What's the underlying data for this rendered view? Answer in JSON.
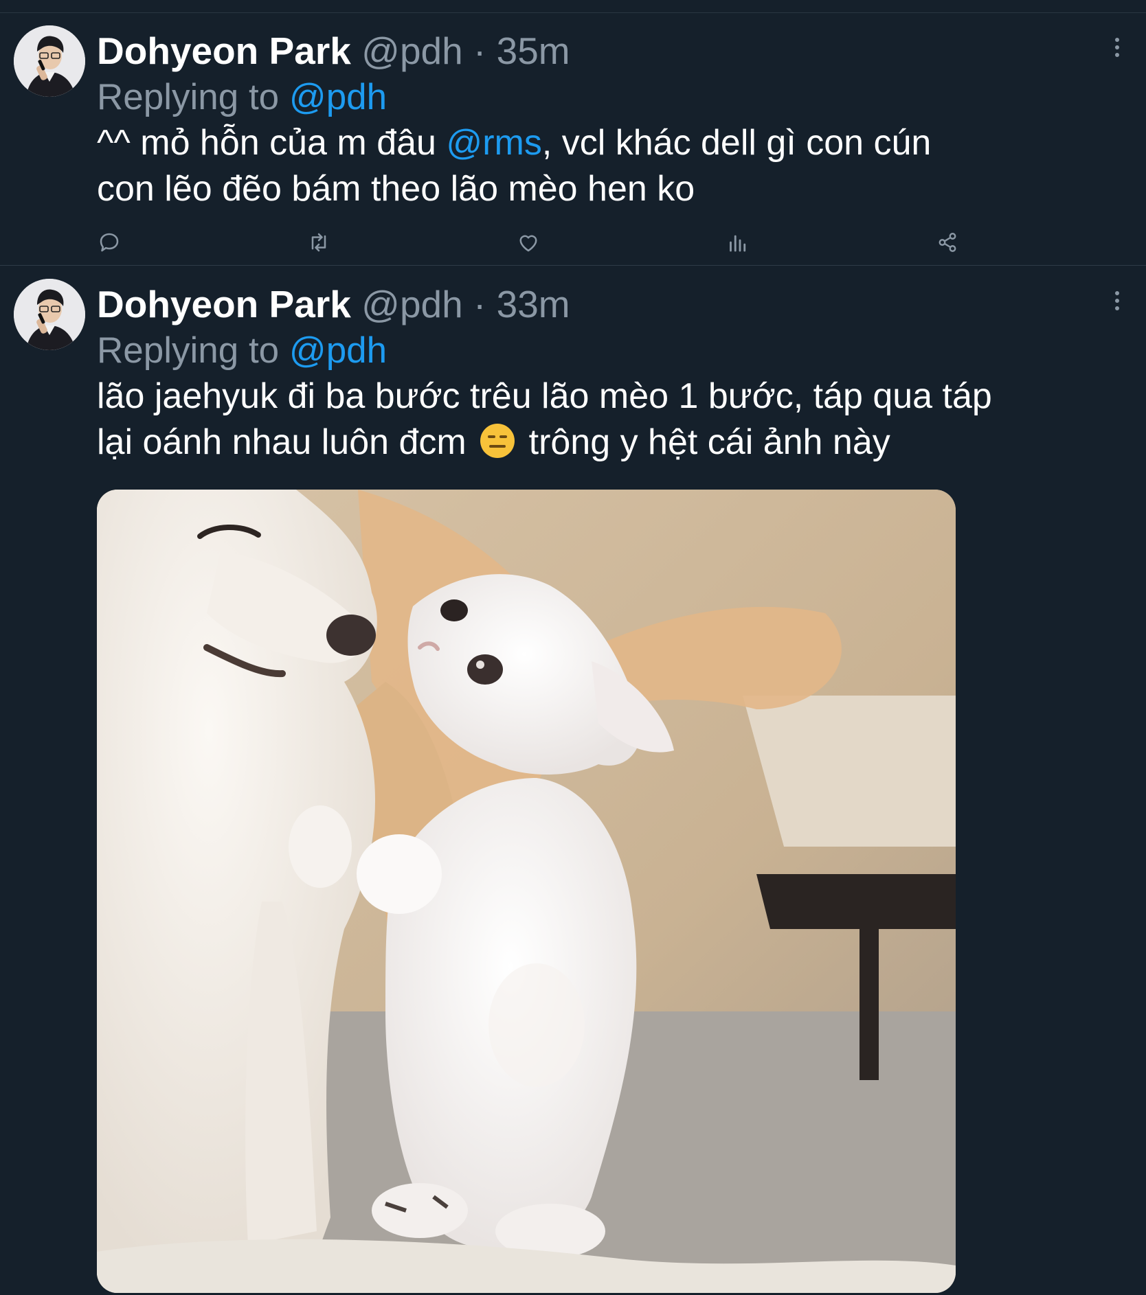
{
  "tweets": [
    {
      "author_name": "Dohyeon Park",
      "author_handle": "@pdh",
      "separator": "·",
      "time": "35m",
      "replying_prefix": "Replying to ",
      "replying_handle": "@pdh",
      "text_line1_a": "^^ mỏ hỗn của m đâu ",
      "text_line1_mention": "@rms",
      "text_line1_b": ", vcl khác dell gì con cún",
      "text_line2": "con lẽo đẽo bám theo lão mèo hen ko",
      "actions": [
        "reply-icon",
        "retweet-icon",
        "like-icon",
        "analytics-icon",
        "share-icon"
      ]
    },
    {
      "author_name": "Dohyeon Park",
      "author_handle": "@pdh",
      "separator": "·",
      "time": "33m",
      "replying_prefix": "Replying to ",
      "replying_handle": "@pdh",
      "text_line1": "lão jaehyuk đi ba bước trêu lão mèo 1 bước, táp qua táp",
      "text_line2_a": "lại oánh nhau luôn đcm ",
      "text_line2_emoji": "expressionless-face-emoji",
      "text_line2_b": " trông y hệt cái ảnh này",
      "media": "photo of a white dog and a white kitten"
    }
  ],
  "colors": {
    "background": "#15202b",
    "secondary_text": "#8b98a5",
    "link": "#1d9bf0",
    "divider": "#2f3b47"
  }
}
